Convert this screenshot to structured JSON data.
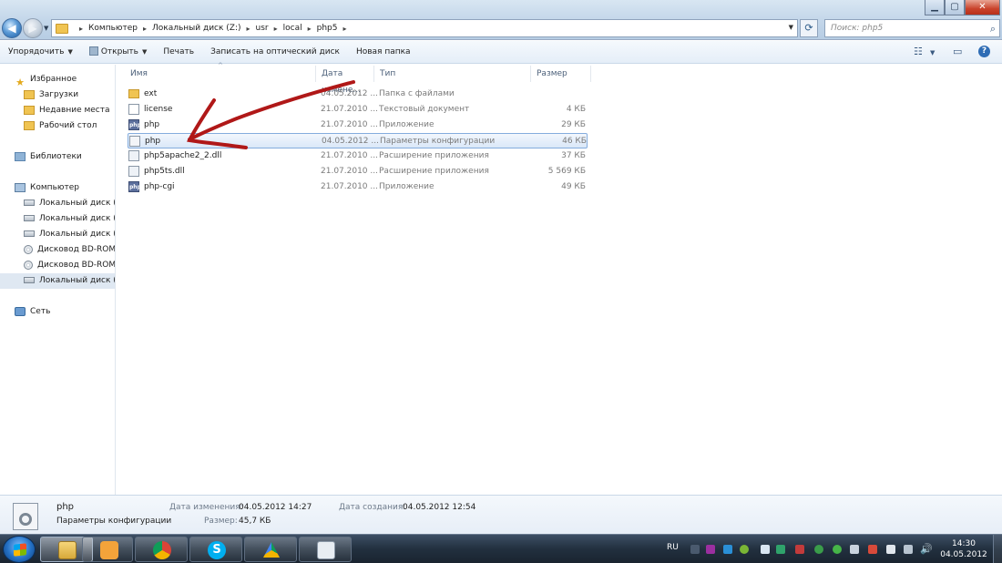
{
  "window": {
    "minimize_icon": "minimize-icon",
    "maximize_icon": "maximize-icon",
    "close_icon": "close-icon"
  },
  "address": {
    "crumbs": [
      "Компьютер",
      "Локальный диск (Z:)",
      "usr",
      "local",
      "php5"
    ],
    "search_placeholder": "Поиск: php5"
  },
  "toolbar": {
    "organize": "Упорядочить",
    "open": "Открыть",
    "print": "Печать",
    "burn": "Записать на оптический диск",
    "new_folder": "Новая папка"
  },
  "sidebar": {
    "items": [
      {
        "label": "Избранное",
        "icon": "star-icon"
      },
      {
        "label": "Загрузки",
        "icon": "folder-icon"
      },
      {
        "label": "Недавние места",
        "icon": "folder-icon"
      },
      {
        "label": "Рабочий стол",
        "icon": "folder-icon"
      },
      {
        "label": "Библиотеки",
        "icon": "library-icon"
      },
      {
        "label": "Компьютер",
        "icon": "computer-icon"
      },
      {
        "label": "Локальный диск (C",
        "icon": "drive-icon"
      },
      {
        "label": "Локальный диск (D",
        "icon": "drive-icon"
      },
      {
        "label": "Локальный диск (E:",
        "icon": "drive-icon"
      },
      {
        "label": "Дисковод BD-ROM",
        "icon": "disc-icon"
      },
      {
        "label": "Дисковод BD-ROM",
        "icon": "disc-icon"
      },
      {
        "label": "Локальный диск (Z",
        "icon": "drive-icon",
        "selected": true
      },
      {
        "label": "Сеть",
        "icon": "network-icon"
      }
    ]
  },
  "columns": {
    "name": "Имя",
    "date": "Дата измене...",
    "type": "Тип",
    "size": "Размер"
  },
  "files": [
    {
      "name": "ext",
      "date": "04.05.2012 ...",
      "type": "Папка с файлами",
      "size": "",
      "icon": "folder"
    },
    {
      "name": "license",
      "date": "21.07.2010 ...",
      "type": "Текстовый документ",
      "size": "4 КБ",
      "icon": "text"
    },
    {
      "name": "php",
      "date": "21.07.2010 ...",
      "type": "Приложение",
      "size": "29 КБ",
      "icon": "php"
    },
    {
      "name": "php",
      "date": "04.05.2012 ...",
      "type": "Параметры конфигурации",
      "size": "46 КБ",
      "icon": "ini",
      "selected": true
    },
    {
      "name": "php5apache2_2.dll",
      "date": "21.07.2010 ...",
      "type": "Расширение приложения",
      "size": "37 КБ",
      "icon": "dll"
    },
    {
      "name": "php5ts.dll",
      "date": "21.07.2010 ...",
      "type": "Расширение приложения",
      "size": "5 569 КБ",
      "icon": "dll"
    },
    {
      "name": "php-cgi",
      "date": "21.07.2010 ...",
      "type": "Приложение",
      "size": "49 КБ",
      "icon": "php"
    }
  ],
  "details": {
    "name": "php",
    "type": "Параметры конфигурации",
    "modified_label": "Дата изменения:",
    "modified_value": "04.05.2012 14:27",
    "created_label": "Дата создания:",
    "created_value": "04.05.2012 12:54",
    "size_label": "Размер:",
    "size_value": "45,7 КБ"
  },
  "taskbar": {
    "language": "RU",
    "time": "14:30",
    "date": "04.05.2012",
    "apps": [
      "explorer",
      "media-player",
      "chrome",
      "skype",
      "google-drive",
      "notepad"
    ]
  },
  "colors": {
    "selection_border": "#84acdd",
    "annotation_arrow": "#b01818"
  }
}
